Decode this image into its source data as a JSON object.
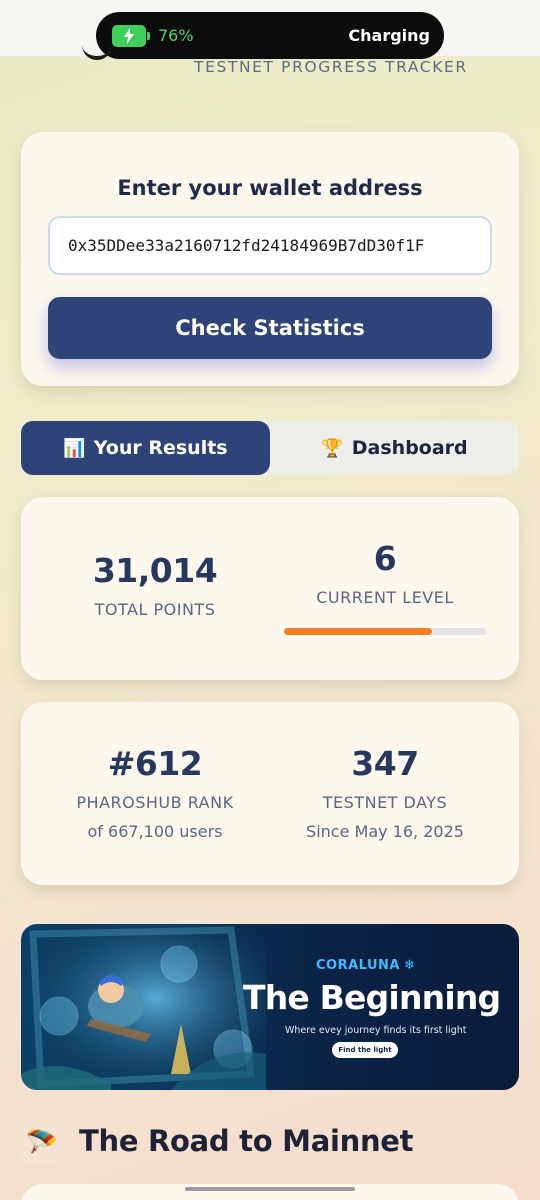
{
  "status_bar": {
    "battery_percent": "76%",
    "charging_label": "Charging"
  },
  "header": {
    "subtitle": "TESTNET PROGRESS TRACKER"
  },
  "wallet": {
    "heading": "Enter your wallet address",
    "address_value": "0x35DDee33a2160712fd24184969B7dD30f1F",
    "check_button_label": "Check Statistics"
  },
  "tabs": [
    {
      "icon": "bar-chart-icon",
      "glyph": "📊",
      "label": "Your Results",
      "active": true
    },
    {
      "icon": "trophy-icon",
      "glyph": "🏆",
      "label": "Dashboard",
      "active": false
    }
  ],
  "stats": {
    "total_points": {
      "value": "31,014",
      "label": "TOTAL POINTS"
    },
    "current_level": {
      "value": "6",
      "label": "CURRENT LEVEL",
      "progress_fraction": 0.73
    },
    "rank": {
      "value": "#612",
      "label": "PHAROSHUB RANK",
      "sub": "of 667,100 users"
    },
    "testnet_days": {
      "value": "347",
      "label": "TESTNET DAYS",
      "sub": "Since May 16, 2025"
    }
  },
  "colors": {
    "primary": "#2e4478",
    "progress": "#f47d22",
    "card_bg": "#fdf8ee",
    "banner_accent": "#49b8ff"
  },
  "banner": {
    "brand": "CORALUNA",
    "title": "The Beginning",
    "tagline": "Where evey journey finds its first  light",
    "button_label": "Find the light"
  },
  "section": {
    "icon": "parachute-icon",
    "glyph": "🪂",
    "title": "The Road to Mainnet"
  }
}
